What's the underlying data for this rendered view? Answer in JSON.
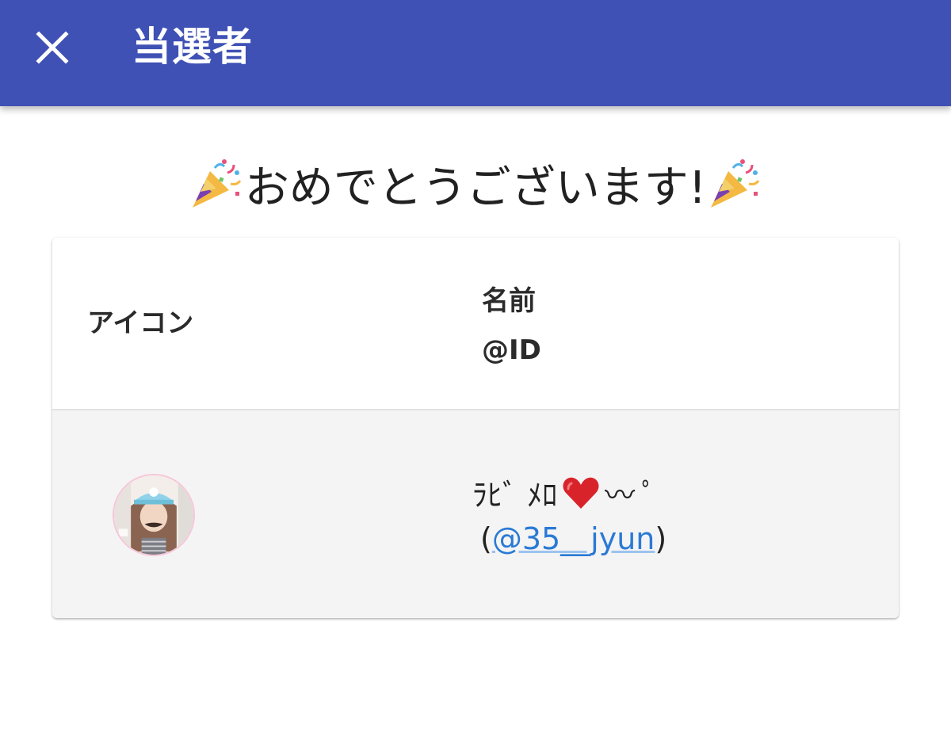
{
  "appbar": {
    "title": "当選者",
    "close_icon": "close-icon",
    "color": "#3f51b5"
  },
  "congrats": {
    "text": "おめでとうございます!",
    "icon": "party-popper-icon"
  },
  "table": {
    "headers": {
      "icon": "アイコン",
      "name": "名前",
      "id": "@ID"
    },
    "rows": [
      {
        "avatar": "avatar",
        "name_prefix": "ﾗﾋﾞ ﾒﾛ",
        "name_suffix": "〰 ﾟ",
        "heart_icon": "red-heart-icon",
        "id_open": "(",
        "id": "@35__jyun",
        "id_close": ")"
      }
    ]
  },
  "colors": {
    "link": "#2a7ad5",
    "row_background": "#f4f4f4"
  }
}
